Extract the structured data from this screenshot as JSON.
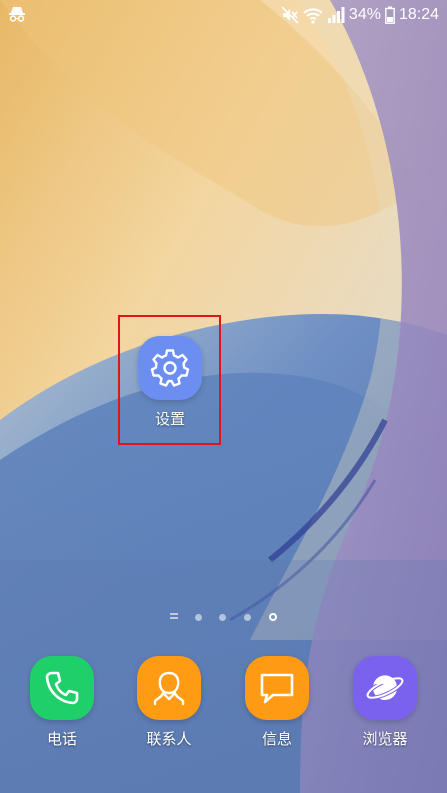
{
  "status_bar": {
    "battery_text": "34%",
    "time": "18:24",
    "icons": [
      "incognito-icon",
      "mute-icon",
      "wifi-icon",
      "signal-icon",
      "battery-icon"
    ]
  },
  "home_screen": {
    "apps": [
      {
        "label": "设置",
        "icon": "gear-icon",
        "color": "#6b8ef0"
      }
    ],
    "page_indicator": {
      "pages": 5,
      "active_page": 5
    }
  },
  "dock": {
    "apps": [
      {
        "label": "电话",
        "icon": "phone-icon",
        "color": "#1fcf6a"
      },
      {
        "label": "联系人",
        "icon": "contact-icon",
        "color": "#ff9c13"
      },
      {
        "label": "信息",
        "icon": "message-icon",
        "color": "#ff9a14"
      },
      {
        "label": "浏览器",
        "icon": "planet-icon",
        "color": "#7b62ee"
      }
    ]
  },
  "highlight_color": "#e0141b"
}
